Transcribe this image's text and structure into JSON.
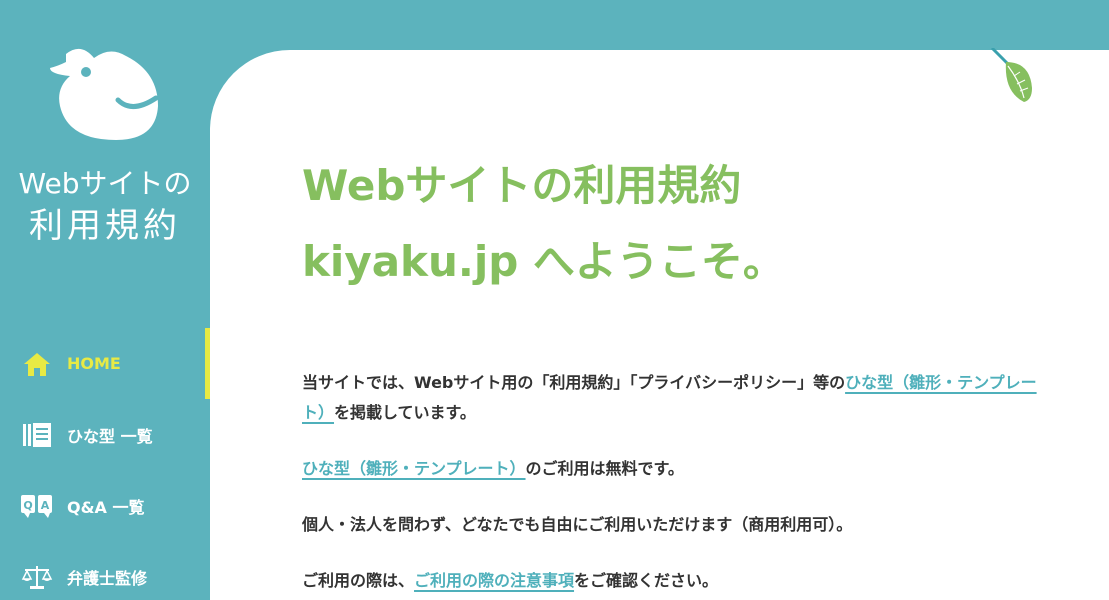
{
  "logo": {
    "line1": "Webサイトの",
    "line2": "利用規約"
  },
  "nav": [
    {
      "label": "HOME",
      "icon": "home-icon",
      "active": true
    },
    {
      "label": "ひな型 一覧",
      "icon": "document-list-icon",
      "active": false
    },
    {
      "label": "Q&A 一覧",
      "icon": "qa-icon",
      "active": false
    },
    {
      "label": "弁護士監修",
      "icon": "scales-icon",
      "active": false
    }
  ],
  "main": {
    "heading_line1": "Webサイトの利用規約",
    "heading_line2": "kiyaku.jp へようこそ。",
    "p1": {
      "text_before": "当サイトでは、Webサイト用の「利用規約」「プライバシーポリシー」等の",
      "link": "ひな型（雛形・テンプレート）",
      "text_after": "を掲載しています。"
    },
    "p2": {
      "link": "ひな型（雛形・テンプレート）",
      "text_after": "のご利用は無料です。"
    },
    "p3": {
      "text": "個人・法人を問わず、どなたでも自由にご利用いただけます（商用利用可）。"
    },
    "p4": {
      "text_before": "ご利用の際は、",
      "link": "ご利用の際の注意事項",
      "text_after": "をご確認ください。"
    }
  },
  "colors": {
    "sidebar": "#5cb3bd",
    "heading": "#86bf5f",
    "active_nav": "#e8ea44",
    "link": "#4fb0bb"
  }
}
